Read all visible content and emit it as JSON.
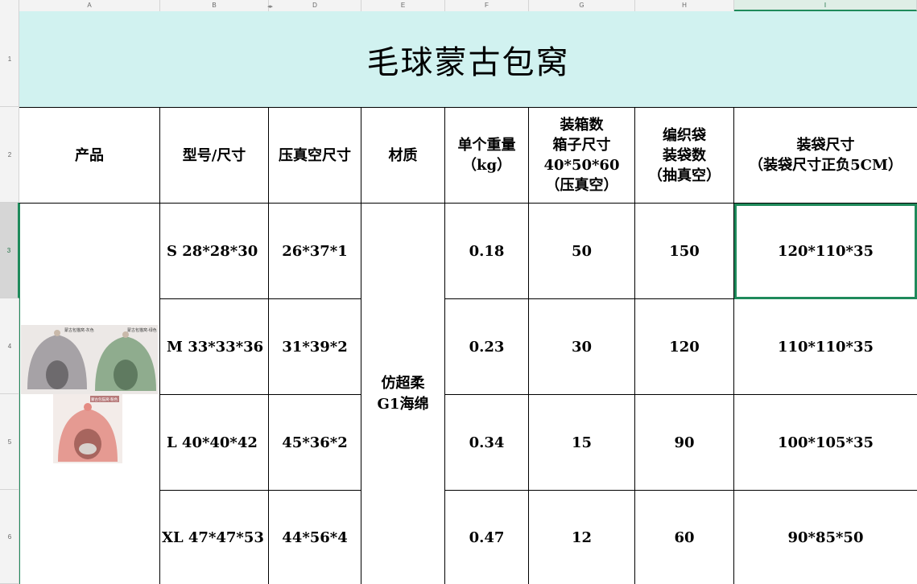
{
  "column_headers": [
    "A",
    "B",
    "",
    "D",
    "E",
    "F",
    "G",
    "H",
    "I"
  ],
  "row_headers": [
    "1",
    "2",
    "3",
    "4",
    "5",
    "6"
  ],
  "title": "毛球蒙古包窝",
  "headers": {
    "product": "产品",
    "model": "型号/尺寸",
    "vacuum": "压真空尺寸",
    "material": "材质",
    "weight": "单个重量\n（kg）",
    "carton": "装箱数\n箱子尺寸\n40*50*60\n（压真空）",
    "woven": "编织袋\n装袋数\n（抽真空）",
    "bag_size": "装袋尺寸\n（装袋尺寸正负5CM）"
  },
  "material_value": "仿超柔\nG1海绵",
  "rows": [
    {
      "model": "S 28*28*30",
      "vacuum": "26*37*1",
      "weight": "0.18",
      "carton": "50",
      "woven": "150",
      "bag_size": "120*110*35"
    },
    {
      "model": "M 33*33*36",
      "vacuum": "31*39*2",
      "weight": "0.23",
      "carton": "30",
      "woven": "120",
      "bag_size": "110*110*35"
    },
    {
      "model": "L 40*40*42",
      "vacuum": "45*36*2",
      "weight": "0.34",
      "carton": "15",
      "woven": "90",
      "bag_size": "100*105*35"
    },
    {
      "model": "XL 47*47*53",
      "vacuum": "44*56*4",
      "weight": "0.47",
      "carton": "12",
      "woven": "60",
      "bag_size": "90*85*50"
    }
  ],
  "product_image_labels": [
    "蒙古包猫窝-灰色",
    "蒙古包猫窝-绿色",
    "蒙古包猫窝-粉色"
  ],
  "colors": {
    "title_bg": "#d1f2f0",
    "grid_line": "#000000",
    "selection": "#1f8a5b",
    "header_bg": "#f3f3f3"
  }
}
